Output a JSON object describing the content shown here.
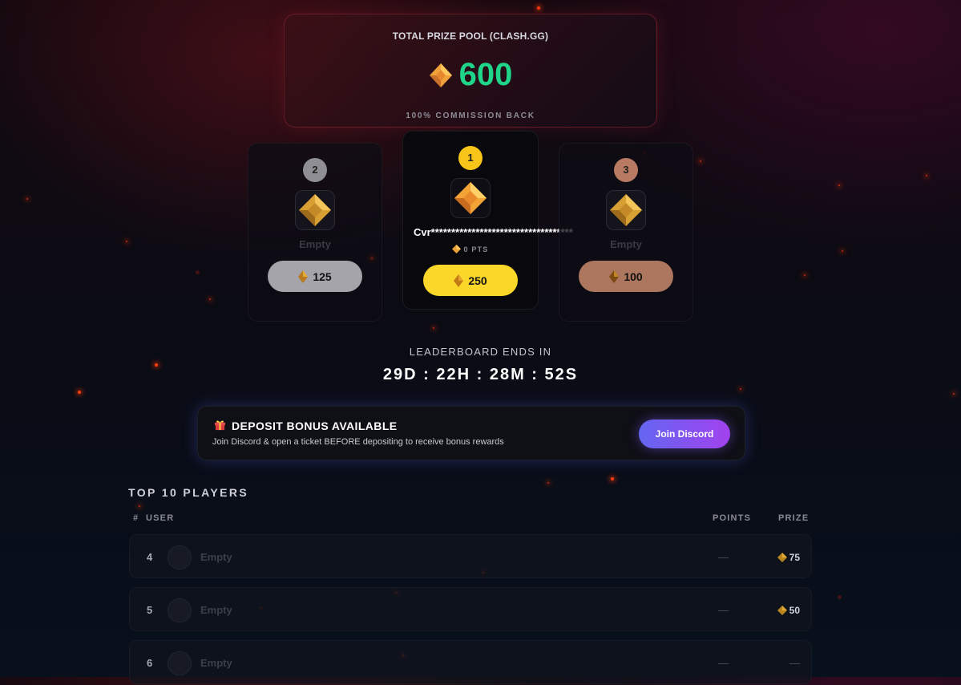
{
  "prize_pool": {
    "title": "TOTAL PRIZE POOL (CLASH.GG)",
    "amount": "600",
    "subtitle": "100% COMMISSION BACK",
    "amount_color": "#1fd58a"
  },
  "podium": [
    {
      "rank": "2",
      "name": "Empty",
      "prize": "125",
      "badge_color": "#8e8e94",
      "pill_color": "#a4a4aa"
    },
    {
      "rank": "1",
      "name": "Cvr***********************************",
      "points": "0 PTS",
      "prize": "250",
      "badge_color": "#f7c41a",
      "pill_color": "#fbd72a"
    },
    {
      "rank": "3",
      "name": "Empty",
      "prize": "100",
      "badge_color": "#b87a62",
      "pill_color": "#ad765e"
    }
  ],
  "leaderboard": {
    "label": "LEADERBOARD ENDS IN",
    "timer": "29D : 22H : 28M : 52S"
  },
  "bonus": {
    "icon": "gift-icon",
    "title": "DEPOSIT BONUS AVAILABLE",
    "subtitle": "Join Discord & open a ticket BEFORE depositing to receive bonus rewards",
    "button": "Join Discord"
  },
  "top_players": {
    "title": "TOP 10 PLAYERS",
    "headers": {
      "rank": "#",
      "user": "USER",
      "points": "POINTS",
      "prize": "PRIZE"
    },
    "rows": [
      {
        "rank": "4",
        "name": "Empty",
        "points": "—",
        "prize": "75"
      },
      {
        "rank": "5",
        "name": "Empty",
        "points": "—",
        "prize": "50"
      },
      {
        "rank": "6",
        "name": "Empty",
        "points": "—",
        "prize": "—"
      }
    ]
  }
}
